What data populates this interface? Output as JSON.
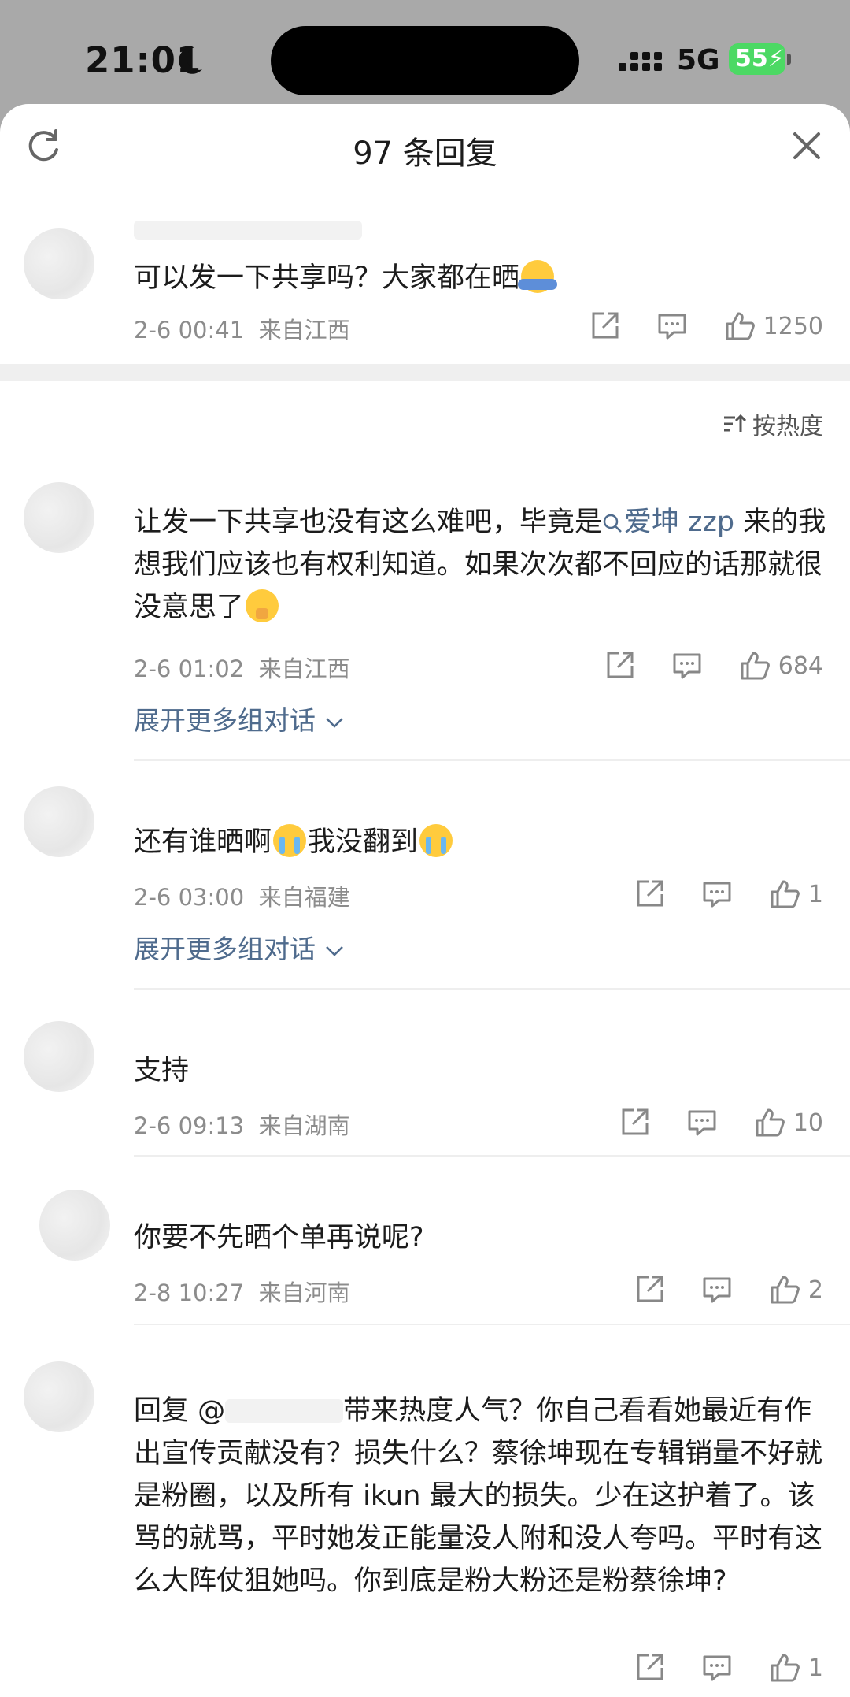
{
  "status": {
    "time": "21:01",
    "network": "5G",
    "battery": "55"
  },
  "header": {
    "title": "97 条回复"
  },
  "sort_label": "按热度",
  "expand_label": "展开更多组对话",
  "top_comment": {
    "text": "可以发一下共享吗？大家都在晒",
    "date": "2-6 00:41",
    "location": "来自江西",
    "likes": "1250"
  },
  "replies": [
    {
      "text_before": "让发一下共享也没有这么难吧，毕竟是",
      "mention": "爱坤 zzp",
      "text_after": "来的我想我们应该也有权利知道。如果次次都不回应的话那就很没意思了",
      "date": "2-6 01:02",
      "location": "来自江西",
      "likes": "684"
    },
    {
      "text_a": "还有谁晒啊",
      "text_b": "我没翻到",
      "date": "2-6 03:00",
      "location": "来自福建",
      "likes": "1"
    },
    {
      "text": "支持",
      "date": "2-6 09:13",
      "location": "来自湖南",
      "likes": "10"
    },
    {
      "text": "你要不先晒个单再说呢?",
      "date": "2-8 10:27",
      "location": "来自河南",
      "likes": "2"
    },
    {
      "prefix": "回复 @",
      "text": "带来热度人气？你自己看看她最近有作出宣传贡献没有？损失什么？蔡徐坤现在专辑销量不好就是粉圈，以及所有 ikun 最大的损失。少在这护着了。该骂的就骂，平时她发正能量没人附和没人夸吗。平时有这么大阵仗狙她吗。你到底是粉大粉还是粉蔡徐坤?",
      "likes": "1"
    }
  ],
  "colors": {
    "link": "#4f6b8d",
    "meta": "#8c8c8c",
    "battery": "#4cd964"
  }
}
